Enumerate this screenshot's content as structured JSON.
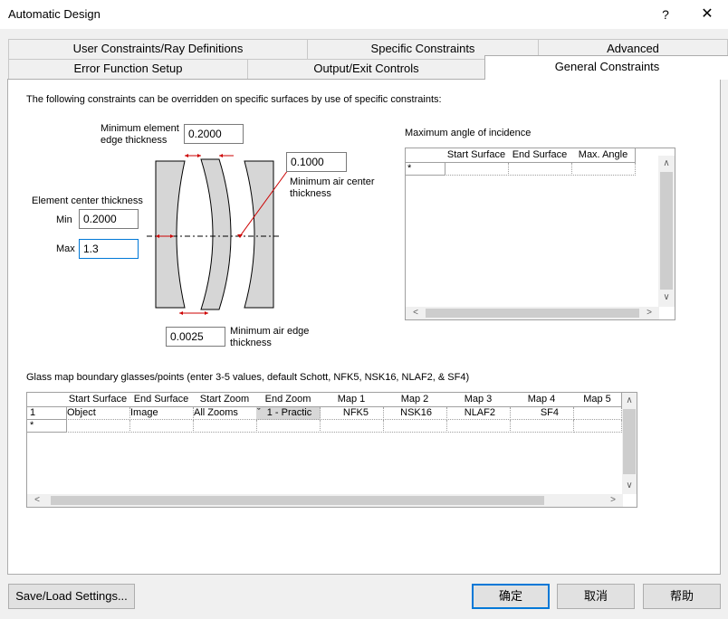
{
  "window": {
    "title": "Automatic Design",
    "help_glyph": "?",
    "close_glyph": "✕"
  },
  "tabs": {
    "row1": [
      "User Constraints/Ray Definitions",
      "Specific Constraints",
      "Advanced"
    ],
    "row2": [
      "Error Function Setup",
      "Output/Exit Controls",
      "General Constraints"
    ],
    "active": "General Constraints"
  },
  "intro_text": "The following constraints can be overridden on specific surfaces by use of specific constraints:",
  "lens": {
    "min_edge_label_1": "Minimum element",
    "min_edge_label_2": "edge thickness",
    "min_edge_value": "0.2000",
    "center_thickness_label": "Element center thickness",
    "min_label": "Min",
    "min_value": "0.2000",
    "max_label": "Max",
    "max_value": "1.3",
    "min_air_center_value": "0.1000",
    "min_air_center_label_1": "Minimum air center",
    "min_air_center_label_2": "thickness",
    "min_air_edge_value": "0.0025",
    "min_air_edge_label_1": "Minimum air edge",
    "min_air_edge_label_2": "thickness"
  },
  "aoi": {
    "label": "Maximum angle of incidence",
    "columns": [
      "Start Surface",
      "End Surface",
      "Max. Angle"
    ],
    "new_row_marker": "*"
  },
  "glassmap": {
    "label": "Glass map boundary glasses/points (enter 3-5 values, default Schott, NFK5, NSK16, NLAF2, & SF4)",
    "columns": [
      "Start Surface",
      "End Surface",
      "Start Zoom",
      "End Zoom",
      "Map 1",
      "Map 2",
      "Map 3",
      "Map 4",
      "Map 5"
    ],
    "rows": [
      {
        "header": "1",
        "cells": [
          "Object",
          "Image",
          "All Zooms",
          "1 - Practic",
          "NFK5",
          "NSK16",
          "NLAF2",
          "SF4",
          ""
        ]
      }
    ],
    "new_row_marker": "*",
    "dropdown_marker": "ˇ"
  },
  "buttons": {
    "save_load": "Save/Load Settings...",
    "ok": "确定",
    "cancel": "取消",
    "help": "帮助"
  },
  "colors": {
    "accent": "#0078d7",
    "lens_fill": "#d6d6d6",
    "arrow_red": "#cc0000"
  }
}
